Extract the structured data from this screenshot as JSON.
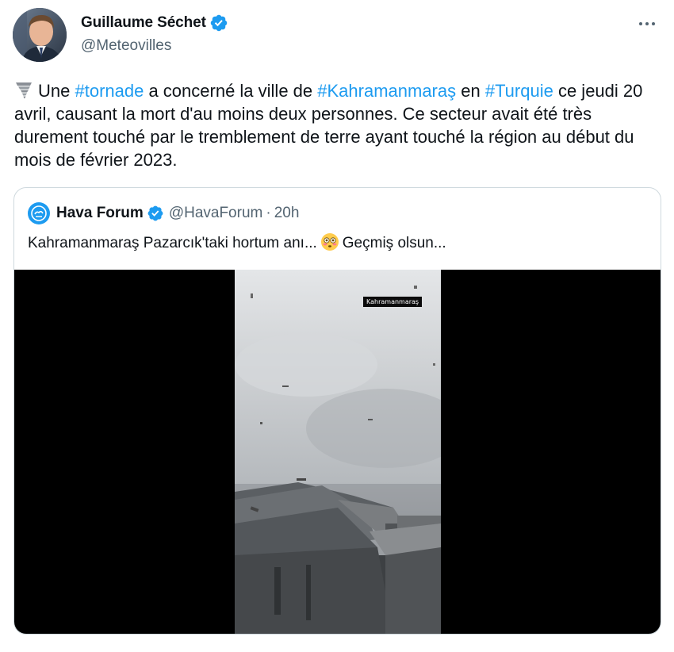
{
  "tweet": {
    "author_name": "Guillaume Séchet",
    "author_handle": "@Meteovilles",
    "more_icon": "more-horizontal-icon",
    "text": {
      "emoji": "tornado-emoji",
      "part1": "Une ",
      "hashtag1": "#tornade",
      "part2": " a concerné la ville de ",
      "hashtag2": "#Kahramanmaraş",
      "part3": " en ",
      "hashtag3": "#Turquie",
      "part4": " ce jeudi 20 avril, causant la mort d'au moins deux personnes. Ce secteur avait été très durement touché par le tremblement de terre ayant touché la région au début du mois de février 2023."
    }
  },
  "quoted_tweet": {
    "author_name": "Hava Forum",
    "author_handle": "@HavaForum",
    "separator": "·",
    "time": "20h",
    "text_before": "Kahramanmaraş Pazarcık'taki hortum anı...",
    "emoji": "flushed-face-emoji",
    "text_after": "Geçmiş olsun...",
    "video_overlay_label": "Kahramanmaraş"
  },
  "colors": {
    "link": "#1d9bf0",
    "text": "#0f1419",
    "secondary": "#536471",
    "border": "#cfd9de",
    "verified": "#1d9bf0"
  }
}
